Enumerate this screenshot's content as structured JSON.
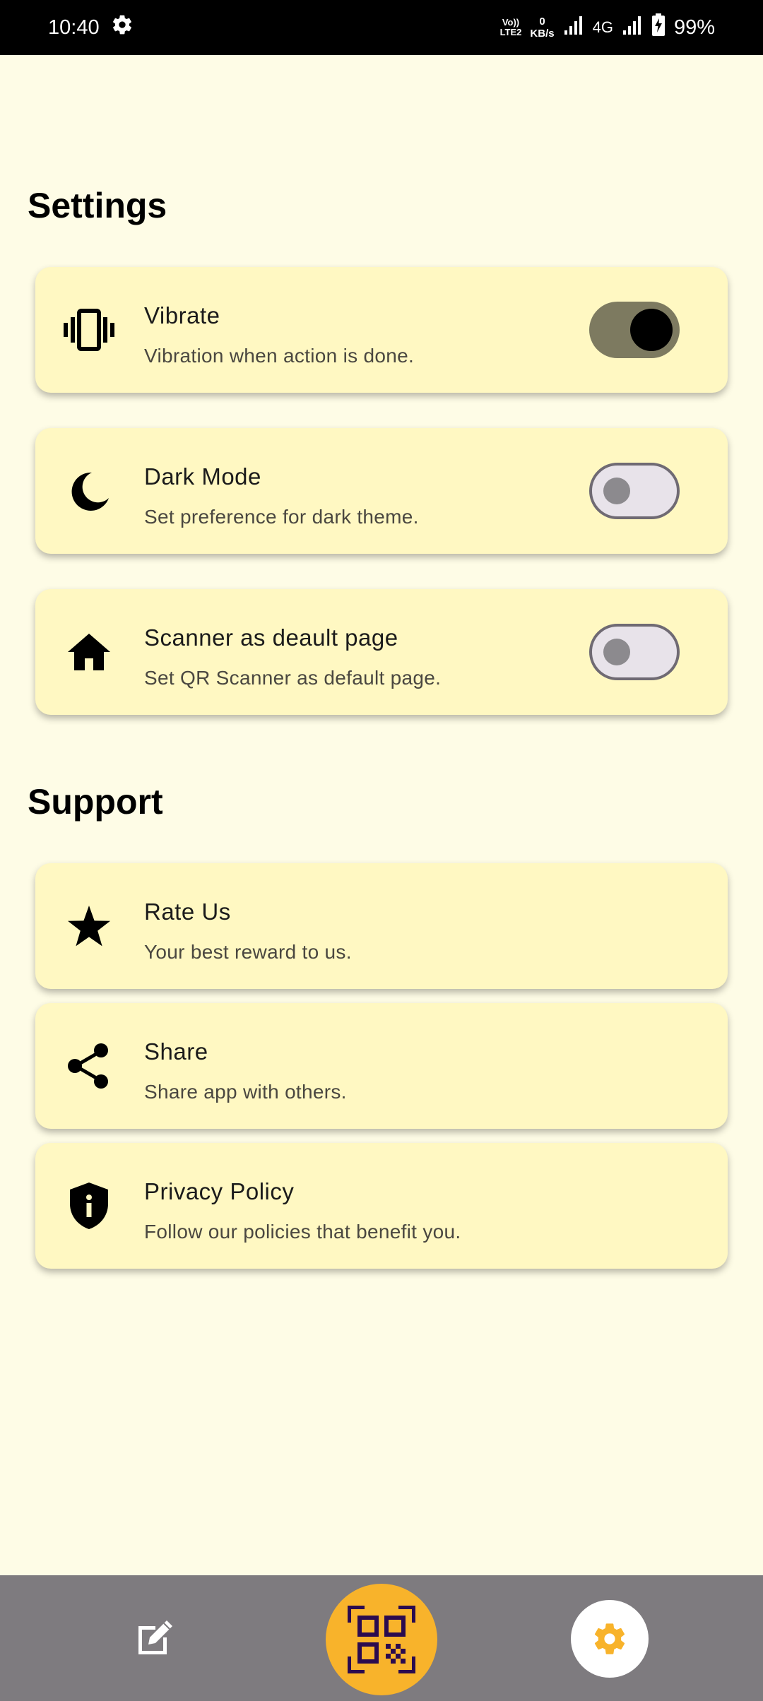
{
  "status_bar": {
    "time": "10:40",
    "volte": "Vo))",
    "lte": "LTE2",
    "net_speed_value": "0",
    "net_speed_unit": "KB/s",
    "network_type": "4G",
    "battery": "99%"
  },
  "sections": {
    "settings_title": "Settings",
    "support_title": "Support"
  },
  "settings": {
    "vibrate": {
      "title": "Vibrate",
      "subtitle": "Vibration when action is done.",
      "enabled": true,
      "icon": "vibration-icon"
    },
    "dark_mode": {
      "title": "Dark Mode",
      "subtitle": "Set preference for dark theme.",
      "enabled": false,
      "icon": "moon-icon"
    },
    "scanner_default": {
      "title": "Scanner as deault page",
      "subtitle": "Set QR Scanner as default page.",
      "enabled": false,
      "icon": "home-icon"
    }
  },
  "support": {
    "rate_us": {
      "title": "Rate Us",
      "subtitle": "Your best reward to us.",
      "icon": "star-icon"
    },
    "share": {
      "title": "Share",
      "subtitle": "Share app with others.",
      "icon": "share-icon"
    },
    "privacy": {
      "title": "Privacy Policy",
      "subtitle": "Follow our policies that benefit you.",
      "icon": "shield-info-icon"
    }
  },
  "bottom_nav": {
    "items": [
      "edit-icon",
      "qr-code-icon",
      "gear-icon"
    ],
    "active": "gear-icon"
  },
  "colors": {
    "background": "#fefce6",
    "card": "#fff8c2",
    "switch_on_track": "#7d7a60",
    "accent": "#f8b32b",
    "nav_bar": "#7e7b7f",
    "qr_icon": "#2b0b4f"
  }
}
